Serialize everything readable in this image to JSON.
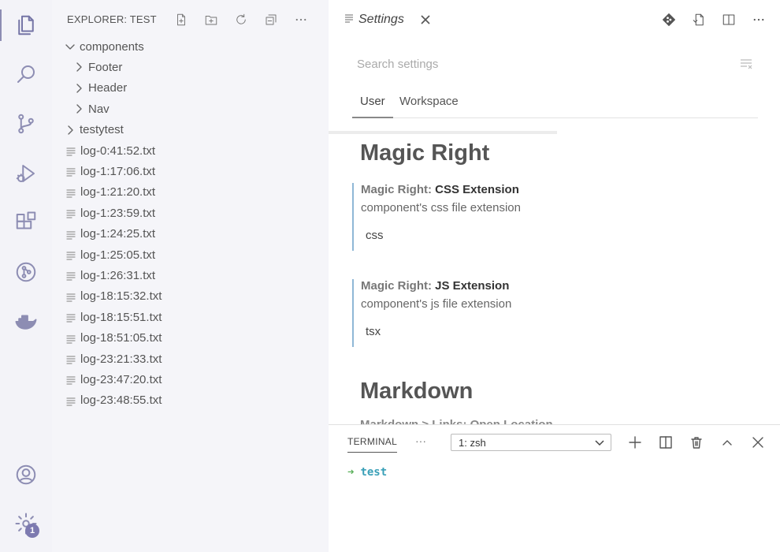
{
  "colors": {
    "activity_bg": "#f3f3f8",
    "sidebar_bg": "#f5f5f9",
    "icon": "#8d8db3",
    "badge": "#7d7ab0",
    "setting_border": "#8fb7d6",
    "terminal_arrow": "#5ab05a",
    "terminal_cwd": "#3aa0b8"
  },
  "activity_bar": {
    "items": [
      {
        "icon": "files-icon"
      },
      {
        "icon": "search-icon"
      },
      {
        "icon": "source-control-icon"
      },
      {
        "icon": "run-debug-icon"
      },
      {
        "icon": "extensions-icon"
      },
      {
        "icon": "git-graph-icon"
      },
      {
        "icon": "docker-icon"
      }
    ],
    "bottom": [
      {
        "icon": "account-icon"
      },
      {
        "icon": "settings-gear-icon"
      }
    ],
    "badge": "1"
  },
  "sidebar": {
    "title": "EXPLORER: TEST",
    "actions": [
      "new-file-icon",
      "new-folder-icon",
      "refresh-icon",
      "collapse-all-icon",
      "more-icon"
    ],
    "tree": [
      {
        "label": "components",
        "kind": "folder-open"
      },
      {
        "label": "Footer",
        "kind": "folder"
      },
      {
        "label": "Header",
        "kind": "folder"
      },
      {
        "label": "Nav",
        "kind": "folder"
      },
      {
        "label": "testytest",
        "kind": "folder"
      },
      {
        "label": "log-0:41:52.txt",
        "kind": "file"
      },
      {
        "label": "log-1:17:06.txt",
        "kind": "file"
      },
      {
        "label": "log-1:21:20.txt",
        "kind": "file"
      },
      {
        "label": "log-1:23:59.txt",
        "kind": "file"
      },
      {
        "label": "log-1:24:25.txt",
        "kind": "file"
      },
      {
        "label": "log-1:25:05.txt",
        "kind": "file"
      },
      {
        "label": "log-1:26:31.txt",
        "kind": "file"
      },
      {
        "label": "log-18:15:32.txt",
        "kind": "file"
      },
      {
        "label": "log-18:15:51.txt",
        "kind": "file"
      },
      {
        "label": "log-18:51:05.txt",
        "kind": "file"
      },
      {
        "label": "log-23:21:33.txt",
        "kind": "file"
      },
      {
        "label": "log-23:47:20.txt",
        "kind": "file"
      },
      {
        "label": "log-23:48:55.txt",
        "kind": "file"
      }
    ]
  },
  "editor": {
    "tab_label": "Settings",
    "actions": [
      "git-icon",
      "open-json-icon",
      "split-editor-icon",
      "more-icon"
    ],
    "search_placeholder": "Search settings",
    "settings_tabs": [
      "User",
      "Workspace"
    ],
    "sections": [
      {
        "title": "Magic Right",
        "settings": [
          {
            "prefix": "Magic Right: ",
            "name": "CSS Extension",
            "desc": "component's css file extension",
            "value": "css"
          },
          {
            "prefix": "Magic Right: ",
            "name": "JS Extension",
            "desc": "component's js file extension",
            "value": "tsx"
          }
        ]
      },
      {
        "title": "Markdown"
      }
    ],
    "cut_text": "Markdown > Links: Open Location"
  },
  "panel": {
    "tab": "TERMINAL",
    "more": "···",
    "terminal_select": "1: zsh",
    "actions": [
      "add-icon",
      "split-terminal-icon",
      "trash-icon",
      "maximize-icon",
      "close-icon"
    ],
    "prompt_arrow": "➜",
    "prompt_dir": "test"
  }
}
